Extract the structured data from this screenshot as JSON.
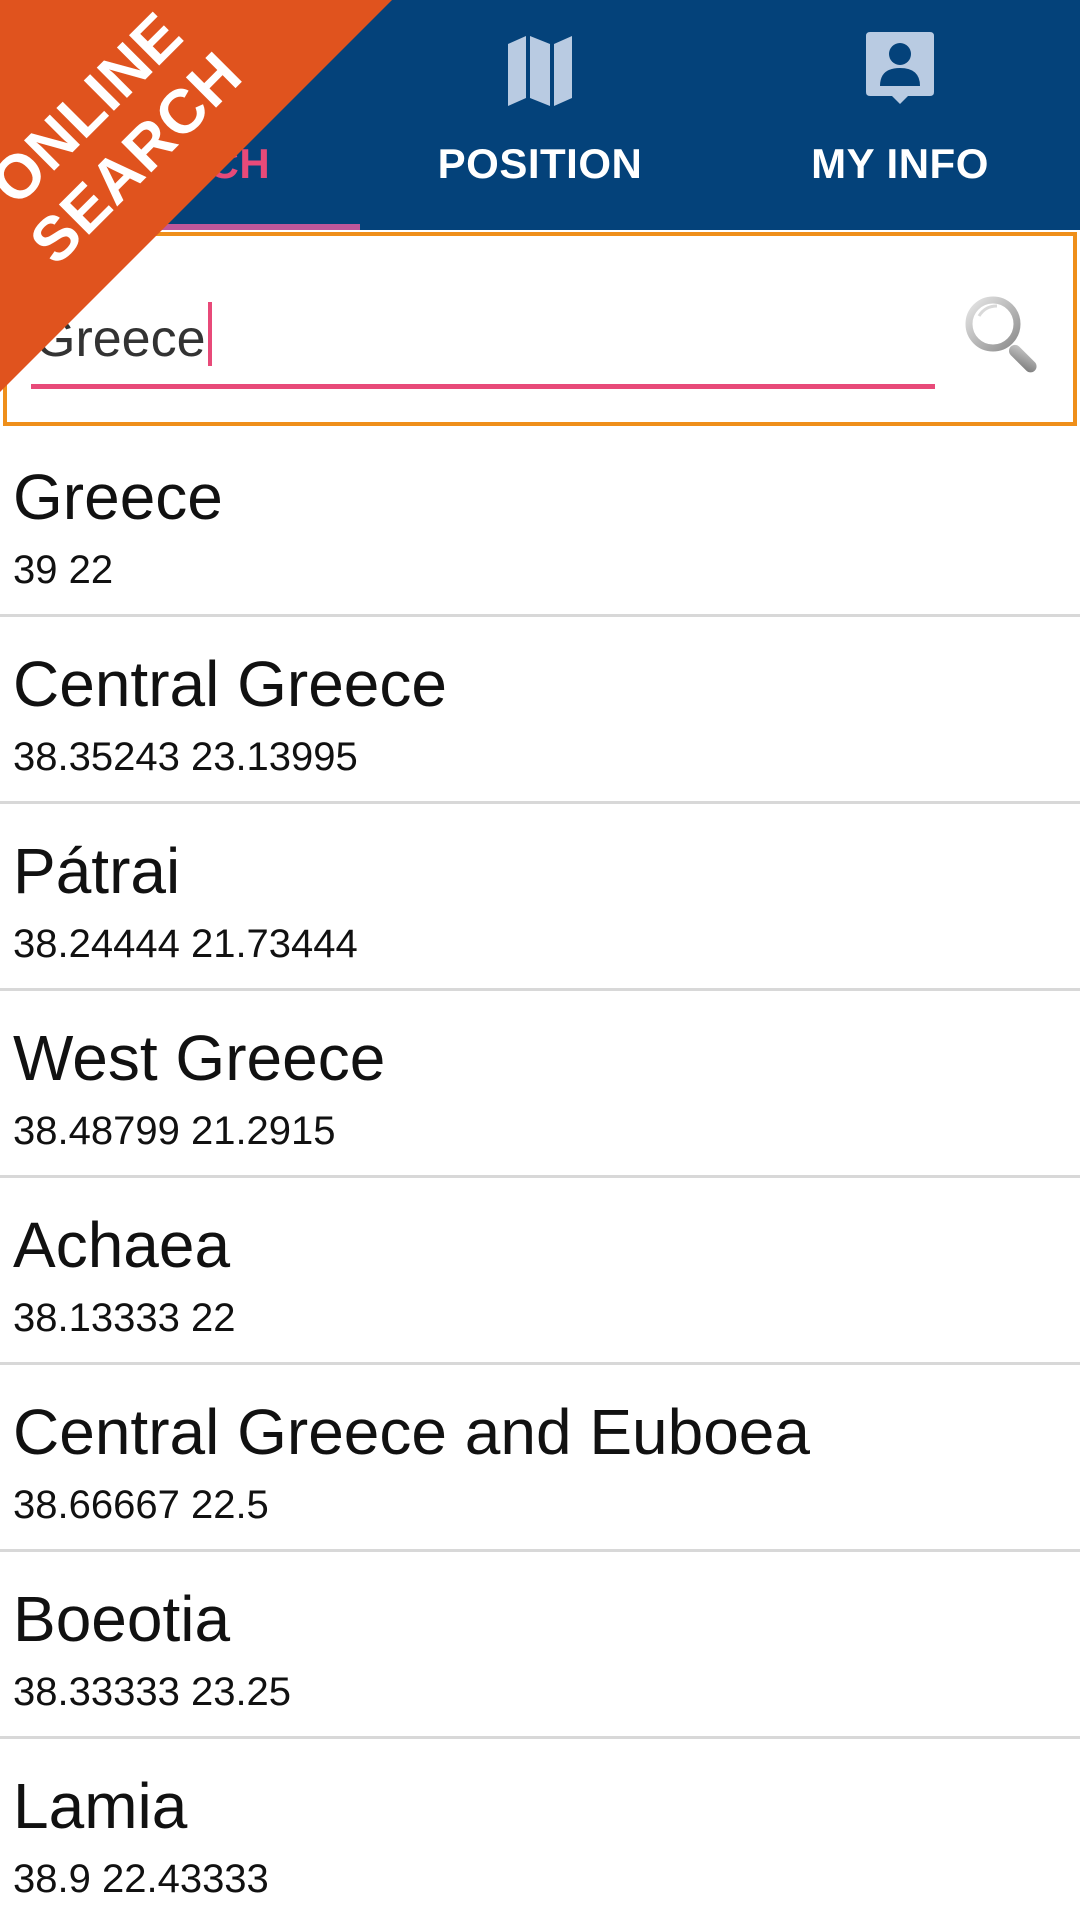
{
  "tabs": [
    {
      "label": "SEARCH",
      "icon": "search-icon",
      "active": true
    },
    {
      "label": "POSITION",
      "icon": "map-icon",
      "active": false
    },
    {
      "label": "MY INFO",
      "icon": "contact-card-icon",
      "active": false
    }
  ],
  "search": {
    "value": "Greece",
    "button_icon": "magnifier-icon"
  },
  "ribbon": {
    "line1": "ONLINE",
    "line2": "SEARCH"
  },
  "results": [
    {
      "name": "Greece",
      "coords": "39 22"
    },
    {
      "name": "Central Greece",
      "coords": "38.35243 23.13995"
    },
    {
      "name": "Pátrai",
      "coords": "38.24444 21.73444"
    },
    {
      "name": "West Greece",
      "coords": "38.48799 21.2915"
    },
    {
      "name": "Achaea",
      "coords": "38.13333 22"
    },
    {
      "name": "Central Greece and Euboea",
      "coords": "38.66667 22.5"
    },
    {
      "name": "Boeotia",
      "coords": "38.33333 23.25"
    },
    {
      "name": "Lamia",
      "coords": "38.9 22.43333"
    }
  ],
  "colors": {
    "tabbar": "#04427a",
    "active_tab": "#e84a79",
    "input_accent": "#e84a79",
    "search_border": "#ef8f1a",
    "ribbon": "#e0531e"
  }
}
